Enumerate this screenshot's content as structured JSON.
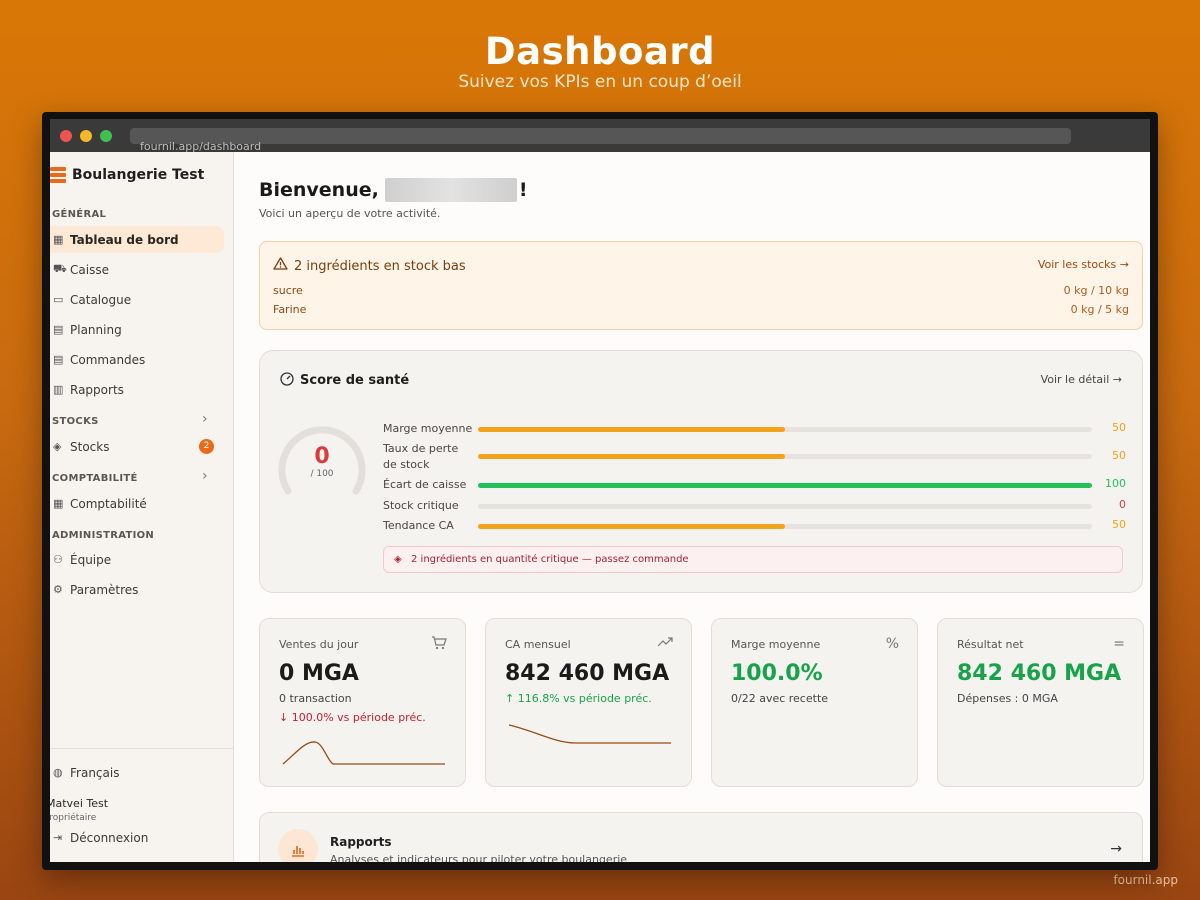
{
  "hero": {
    "title": "Dashboard",
    "subtitle": "Suivez vos KPIs en un coup d’oeil"
  },
  "footer_brand": "fournil.app",
  "browser": {
    "url": "fournil.app/dashboard"
  },
  "sidebar": {
    "brand": "Boulangerie Test",
    "sections": {
      "general": "GÉNÉRAL",
      "stocks": "STOCKS",
      "comptabilite": "COMPTABILITÉ",
      "administration": "ADMINISTRATION"
    },
    "items": {
      "tableau": "Tableau de bord",
      "caisse": "Caisse",
      "catalogue": "Catalogue",
      "planning": "Planning",
      "commandes": "Commandes",
      "rapports": "Rapports",
      "stocks": "Stocks",
      "stocks_badge": "2",
      "comptabilite": "Comptabilité",
      "equipe": "Équipe",
      "parametres": "Paramètres"
    },
    "language": "Français",
    "user_name": "Matvei Test",
    "user_role": "Propriétaire",
    "logout": "Déconnexion"
  },
  "welcome": {
    "greeting": "Bienvenue,",
    "suffix": " !",
    "subtitle": "Voici un aperçu de votre activité."
  },
  "alert": {
    "title": "2 ingrédients en stock bas",
    "link": "Voir les stocks →",
    "rows": [
      {
        "name": "sucre",
        "qty": "0 kg / 10 kg"
      },
      {
        "name": "Farine",
        "qty": "0 kg / 5 kg"
      }
    ]
  },
  "health": {
    "title": "Score de santé",
    "link": "Voir le détail →",
    "score": "0",
    "score_max": "/ 100",
    "metrics": [
      {
        "label": "Marge moyenne",
        "value": "50",
        "pct": 50,
        "color": "#f2a31b"
      },
      {
        "label": "Taux de perte de stock",
        "value": "50",
        "pct": 50,
        "color": "#f2a31b"
      },
      {
        "label": "Écart de caisse",
        "value": "100",
        "pct": 100,
        "color": "#22c05a"
      },
      {
        "label": "Stock critique",
        "value": "0",
        "pct": 0,
        "color": "#dc3b3b"
      },
      {
        "label": "Tendance CA",
        "value": "50",
        "pct": 50,
        "color": "#f2a31b"
      }
    ],
    "critical": "2 ingrédients en quantité critique — passez commande"
  },
  "kpis": {
    "ventes": {
      "label": "Ventes du jour",
      "value": "0 MGA",
      "sub": "0 transaction",
      "trend": "↓ 100.0% vs période préc."
    },
    "ca": {
      "label": "CA mensuel",
      "value": "842 460 MGA",
      "trend": "↑ 116.8% vs période préc."
    },
    "marge": {
      "label": "Marge moyenne",
      "value": "100.0%",
      "sub": "0/22 avec recette"
    },
    "resultat": {
      "label": "Résultat net",
      "value": "842 460 MGA",
      "sub": "Dépenses : 0 MGA"
    }
  },
  "rapports": {
    "title": "Rapports",
    "subtitle": "Analyses et indicateurs pour piloter votre boulangerie"
  },
  "colors": {
    "accent": "#ea6a1a",
    "good": "#17a34a",
    "bad": "#c81e2e"
  }
}
